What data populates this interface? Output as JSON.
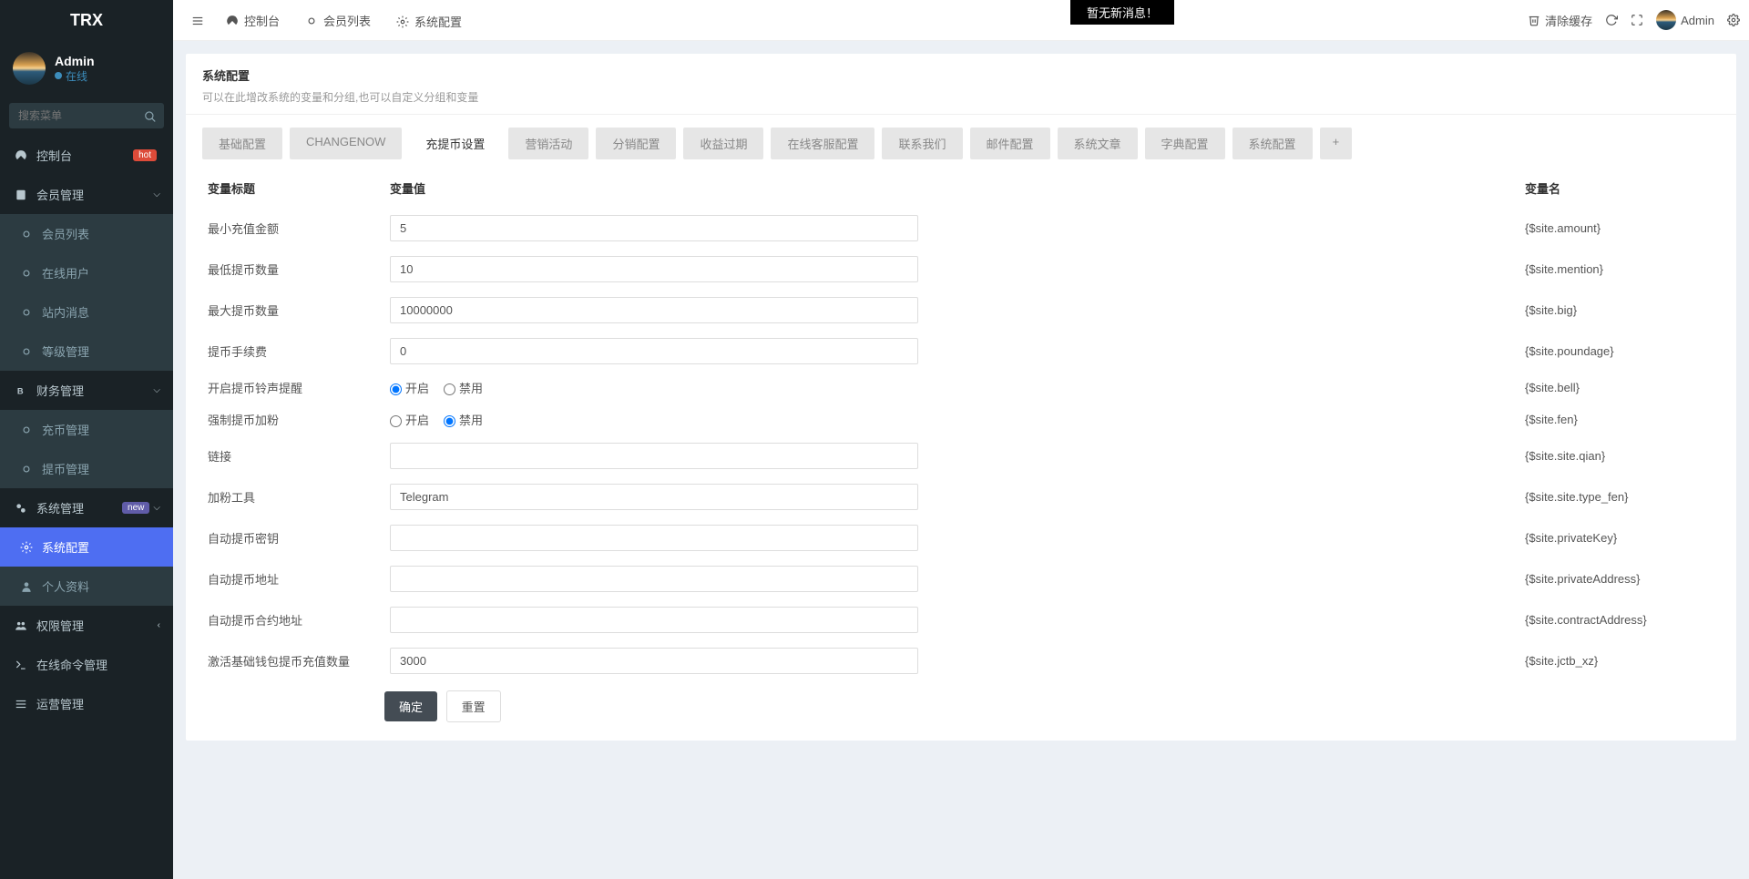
{
  "app": {
    "name": "TRX"
  },
  "user": {
    "name": "Admin",
    "status": "在线"
  },
  "search": {
    "placeholder": "搜索菜单"
  },
  "sidebar": [
    {
      "icon": "dashboard",
      "label": "控制台",
      "badge": "hot",
      "type": "lvl1"
    },
    {
      "icon": "users",
      "label": "会员管理",
      "caret": true,
      "type": "lvl1"
    },
    {
      "icon": "circle",
      "label": "会员列表",
      "type": "sub"
    },
    {
      "icon": "circle",
      "label": "在线用户",
      "type": "sub"
    },
    {
      "icon": "circle",
      "label": "站内消息",
      "type": "sub"
    },
    {
      "icon": "circle",
      "label": "等级管理",
      "type": "sub"
    },
    {
      "icon": "bitcoin",
      "label": "财务管理",
      "caret": true,
      "type": "lvl1"
    },
    {
      "icon": "circle",
      "label": "充币管理",
      "type": "sub"
    },
    {
      "icon": "circle",
      "label": "提币管理",
      "type": "sub"
    },
    {
      "icon": "cogs",
      "label": "系统管理",
      "badge": "new",
      "caret": true,
      "type": "lvl1"
    },
    {
      "icon": "cog",
      "label": "系统配置",
      "type": "sub",
      "active": true
    },
    {
      "icon": "user",
      "label": "个人资料",
      "type": "sub"
    },
    {
      "icon": "group",
      "label": "权限管理",
      "caret": true,
      "caretLeft": true,
      "type": "lvl1"
    },
    {
      "icon": "terminal",
      "label": "在线命令管理",
      "type": "lvl1"
    },
    {
      "icon": "bars",
      "label": "运营管理",
      "type": "lvl1"
    }
  ],
  "topTabs": [
    {
      "icon": "dashboard",
      "label": "控制台"
    },
    {
      "icon": "circle",
      "label": "会员列表"
    },
    {
      "icon": "cog",
      "label": "系统配置",
      "active": true
    }
  ],
  "notice": "暂无新消息！",
  "topRight": {
    "clear": "清除缓存",
    "user": "Admin"
  },
  "panel": {
    "title": "系统配置",
    "subtitle": "可以在此增改系统的变量和分组,也可以自定义分组和变量"
  },
  "cfgTabs": [
    "基础配置",
    "CHANGENOW",
    "充提币设置",
    "营销活动",
    "分销配置",
    "收益过期",
    "在线客服配置",
    "联系我们",
    "邮件配置",
    "系统文章",
    "字典配置",
    "系统配置"
  ],
  "cfgActiveIndex": 2,
  "columns": {
    "title": "变量标题",
    "value": "变量值",
    "name": "变量名"
  },
  "rows": [
    {
      "title": "最小充值金额",
      "type": "text",
      "value": "5",
      "name": "{$site.amount}"
    },
    {
      "title": "最低提币数量",
      "type": "text",
      "value": "10",
      "name": "{$site.mention}"
    },
    {
      "title": "最大提币数量",
      "type": "text",
      "value": "10000000",
      "name": "{$site.big}"
    },
    {
      "title": "提币手续费",
      "type": "text",
      "value": "0",
      "name": "{$site.poundage}"
    },
    {
      "title": "开启提币铃声提醒",
      "type": "radio",
      "options": [
        "开启",
        "禁用"
      ],
      "selected": 0,
      "name": "{$site.bell}"
    },
    {
      "title": "强制提币加粉",
      "type": "radio",
      "options": [
        "开启",
        "禁用"
      ],
      "selected": 1,
      "name": "{$site.fen}"
    },
    {
      "title": "链接",
      "type": "text",
      "value": "",
      "name": "{$site.site.qian}"
    },
    {
      "title": "加粉工具",
      "type": "text",
      "value": "Telegram",
      "name": "{$site.site.type_fen}"
    },
    {
      "title": "自动提币密钥",
      "type": "text",
      "value": "",
      "name": "{$site.privateKey}"
    },
    {
      "title": "自动提币地址",
      "type": "text",
      "value": "",
      "name": "{$site.privateAddress}"
    },
    {
      "title": "自动提币合约地址",
      "type": "text",
      "value": "",
      "name": "{$site.contractAddress}"
    },
    {
      "title": "激活基础钱包提币充值数量",
      "type": "text",
      "value": "3000",
      "name": "{$site.jctb_xz}"
    }
  ],
  "buttons": {
    "ok": "确定",
    "reset": "重置"
  }
}
